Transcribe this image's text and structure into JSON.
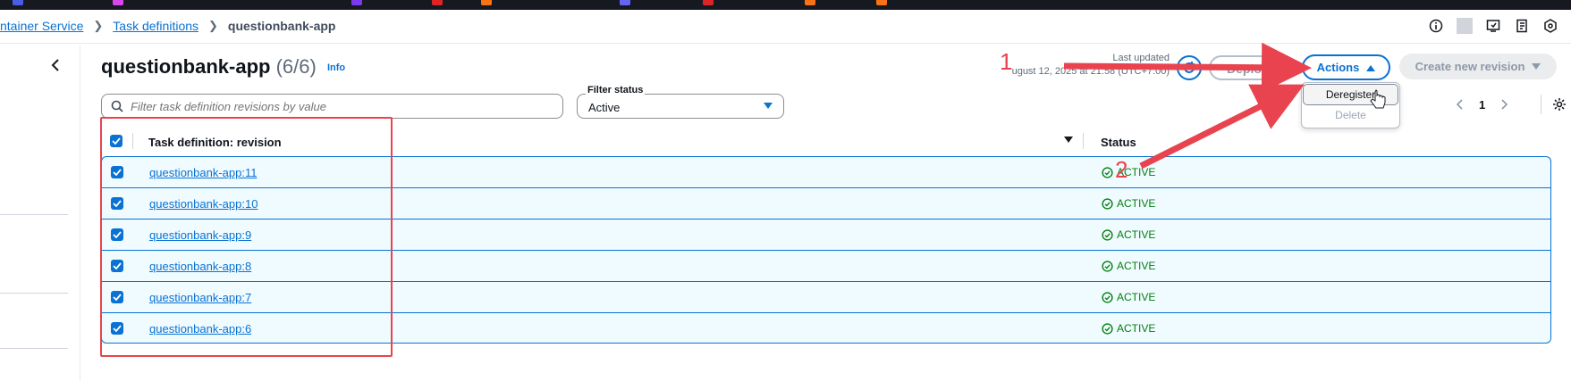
{
  "breadcrumbs": [
    {
      "label": "ntainer Service"
    },
    {
      "label": "Task definitions"
    },
    {
      "label": "questionbank-app"
    }
  ],
  "page": {
    "title": "questionbank-app",
    "count": "(6/6)",
    "info_link": "Info",
    "last_updated_label": "Last updated",
    "last_updated_value": "ugust 12, 2025 at 21:58 (UTC+7:00)"
  },
  "toolbar": {
    "deploy_label": "Deploy",
    "actions_label": "Actions",
    "create_label": "Create new revision"
  },
  "actions_menu": {
    "items": [
      {
        "label": "Deregister",
        "enabled": true
      },
      {
        "label": "Delete",
        "enabled": false
      }
    ]
  },
  "search": {
    "placeholder": "Filter task definition revisions by value"
  },
  "filter": {
    "label": "Filter status",
    "value": "Active"
  },
  "pagination": {
    "current_page": "1"
  },
  "table": {
    "headers": [
      "Task definition: revision",
      "Status"
    ],
    "rows": [
      {
        "name": "questionbank-app:11",
        "status": "ACTIVE"
      },
      {
        "name": "questionbank-app:10",
        "status": "ACTIVE"
      },
      {
        "name": "questionbank-app:9",
        "status": "ACTIVE"
      },
      {
        "name": "questionbank-app:8",
        "status": "ACTIVE"
      },
      {
        "name": "questionbank-app:7",
        "status": "ACTIVE"
      },
      {
        "name": "questionbank-app:6",
        "status": "ACTIVE"
      }
    ]
  },
  "annotations": {
    "step1": "1",
    "step2": "2"
  },
  "colors": {
    "accent": "#0972d3",
    "active_status": "#037f0c",
    "annotation_red": "#e8434e",
    "row_selected_bg": "#f0fbff"
  }
}
